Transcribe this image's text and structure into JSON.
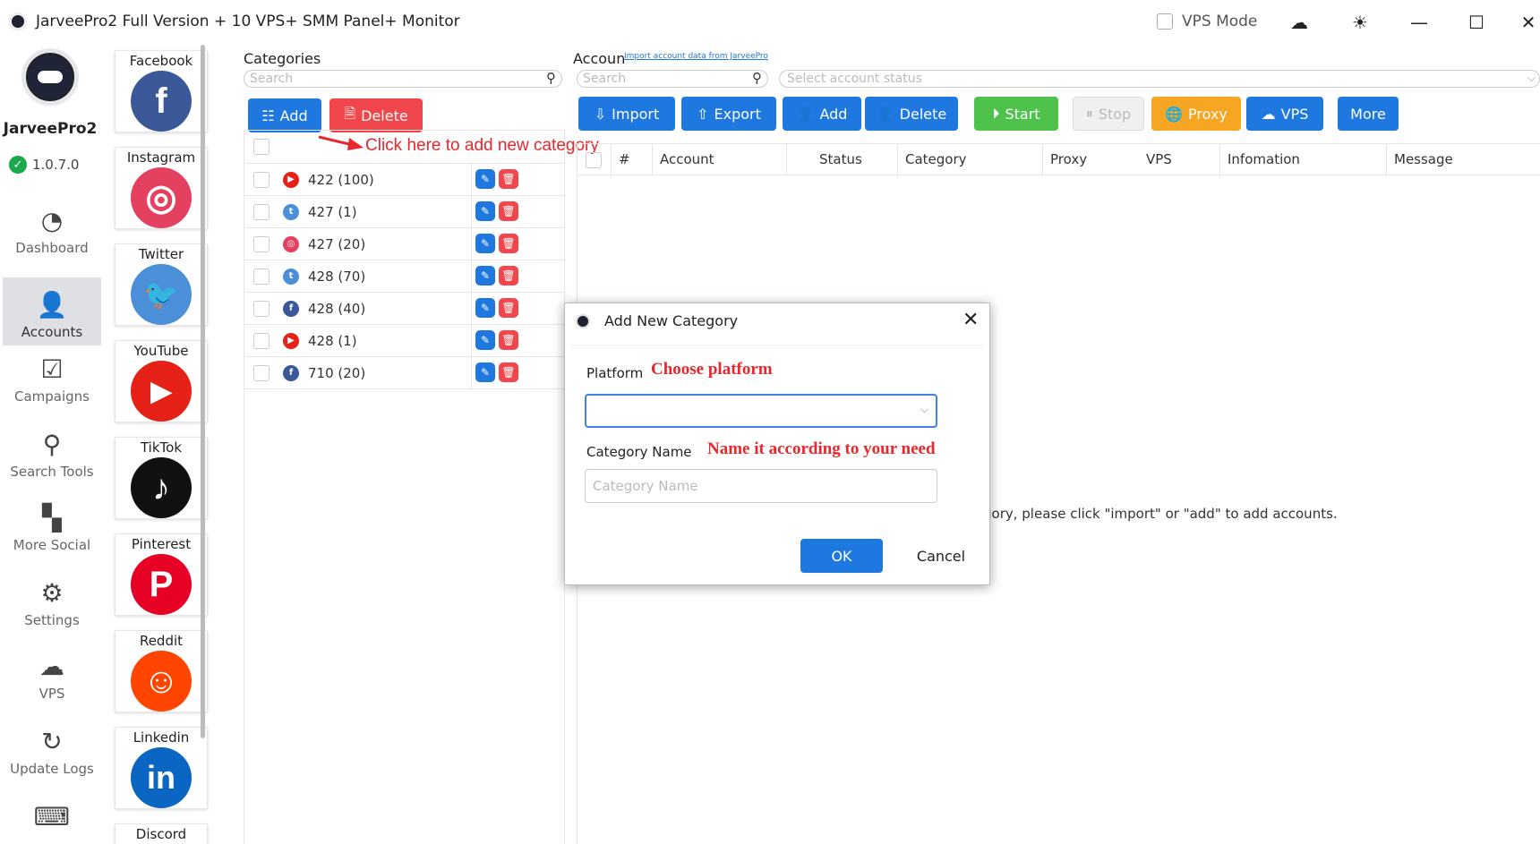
{
  "window": {
    "title": "JarveePro2 Full Version + 10 VPS+ SMM Panel+ Monitor",
    "vps_mode_label": "VPS Mode"
  },
  "brand": {
    "name": "JarveePro2",
    "version": "1.0.7.0"
  },
  "nav": [
    {
      "label": "Dashboard",
      "icon": "gauge-icon"
    },
    {
      "label": "Accounts",
      "icon": "user-icon",
      "active": true
    },
    {
      "label": "Campaigns",
      "icon": "clipboard-check-icon"
    },
    {
      "label": "Search Tools",
      "icon": "magnifier-icon"
    },
    {
      "label": "More Social",
      "icon": "grid-icon"
    },
    {
      "label": "Settings",
      "icon": "gear-icon"
    },
    {
      "label": "VPS",
      "icon": "cloud-server-icon"
    },
    {
      "label": "Update Logs",
      "icon": "history-icon"
    }
  ],
  "platforms": [
    {
      "label": "Facebook",
      "color": "#3b5998",
      "glyph": "f"
    },
    {
      "label": "Instagram",
      "color": "#e4405f",
      "glyph": "◎"
    },
    {
      "label": "Twitter",
      "color": "#4a8fd8",
      "glyph": "🐦"
    },
    {
      "label": "YouTube",
      "color": "#e62117",
      "glyph": "▶"
    },
    {
      "label": "TikTok",
      "color": "#111111",
      "glyph": "♪"
    },
    {
      "label": "Pinterest",
      "color": "#e60023",
      "glyph": "P"
    },
    {
      "label": "Reddit",
      "color": "#ff4500",
      "glyph": "☺"
    },
    {
      "label": "Linkedin",
      "color": "#0a66c2",
      "glyph": "in"
    },
    {
      "label": "Discord",
      "color": "#5865f2",
      "glyph": ""
    }
  ],
  "categories": {
    "title": "Categories",
    "search_placeholder": "Search",
    "add_label": "Add",
    "delete_label": "Delete",
    "rows": [
      {
        "text": "422 (100)",
        "platform_color": "#e62117",
        "glyph": "▶"
      },
      {
        "text": "427 (1)",
        "platform_color": "#4a8fd8",
        "glyph": "t"
      },
      {
        "text": "427 (20)",
        "platform_color": "#e4405f",
        "glyph": "◎"
      },
      {
        "text": "428 (70)",
        "platform_color": "#4a8fd8",
        "glyph": "t"
      },
      {
        "text": "428 (40)",
        "platform_color": "#3b5998",
        "glyph": "f"
      },
      {
        "text": "428 (1)",
        "platform_color": "#e62117",
        "glyph": "▶"
      },
      {
        "text": "710 (20)",
        "platform_color": "#3b5998",
        "glyph": "f"
      }
    ]
  },
  "annotation_add": "Click here to add  new category",
  "accounts": {
    "title": "Accoun",
    "import_link": "Import account data from JarveePro",
    "search_placeholder": "Search",
    "status_placeholder": "Select account status",
    "buttons": {
      "import": "Import",
      "export": "Export",
      "add": "Add",
      "delete": "Delete",
      "start": "Start",
      "stop": "Stop",
      "proxy": "Proxy",
      "vps": "VPS",
      "more": "More"
    },
    "columns": [
      "#",
      "Account",
      "Status",
      "Category",
      "Proxy",
      "VPS",
      "Infomation",
      "Message"
    ],
    "empty_message": "gory, please click \"import\" or \"add\" to add accounts."
  },
  "modal": {
    "title": "Add New Category",
    "platform_label": "Platform",
    "platform_annotation": "Choose platform",
    "category_label": "Category Name",
    "category_annotation": "Name it according to your need",
    "category_placeholder": "Category Name",
    "ok_label": "OK",
    "cancel_label": "Cancel"
  }
}
